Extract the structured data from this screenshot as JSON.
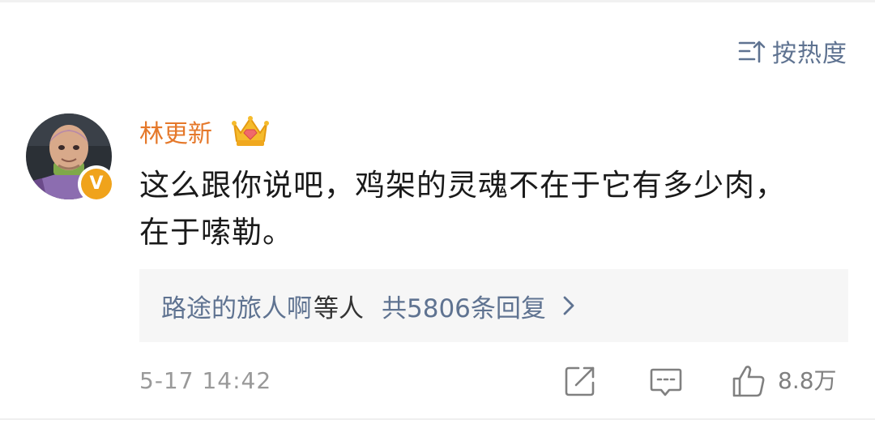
{
  "sort": {
    "label": "按热度",
    "icon": "sort-icon"
  },
  "comment": {
    "author": "林更新",
    "author_color": "#e5782a",
    "crown_icon": "crown-icon",
    "verified_badge_letter": "V",
    "verified_badge_color": "#f0a31b",
    "text_line1": "这么跟你说吧，鸡架的灵魂不在于它有多少肉，",
    "text_line2": "在于嗦勒。",
    "replies": {
      "names": "路途的旅人啊",
      "suffix": "等人",
      "count_label": "共5806条回复",
      "chevron_icon": "chevron-right-icon"
    },
    "timestamp": "5-17 14:42",
    "likes": "8.8万"
  },
  "colors": {
    "link": "#5f7391",
    "text": "#1a1a1a",
    "muted": "#999999",
    "reply_bg": "#f6f6f6"
  }
}
